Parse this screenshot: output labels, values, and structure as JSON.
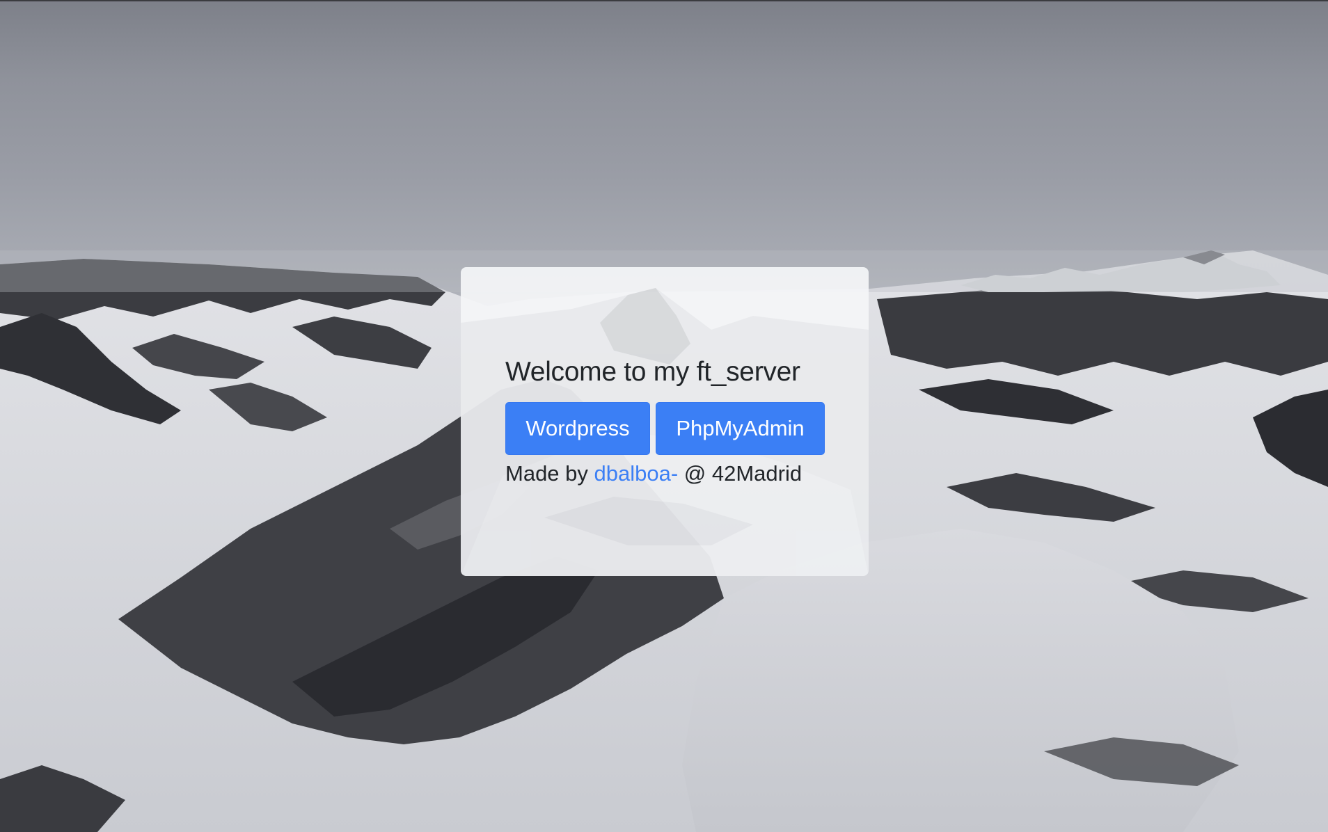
{
  "page": {
    "background_description_colors": {
      "sky": "#9a9da6",
      "snow": "#e4e5e8",
      "rock": "#34353a"
    }
  },
  "card": {
    "title": "Welcome to my ft_server",
    "buttons": {
      "wordpress_label": "Wordpress",
      "phpmyadmin_label": "PhpMyAdmin"
    },
    "credit": {
      "prefix": "Made by ",
      "author": "dbalboa-",
      "suffix": " @ 42Madrid"
    },
    "accent_color": "#3b7ff5"
  }
}
